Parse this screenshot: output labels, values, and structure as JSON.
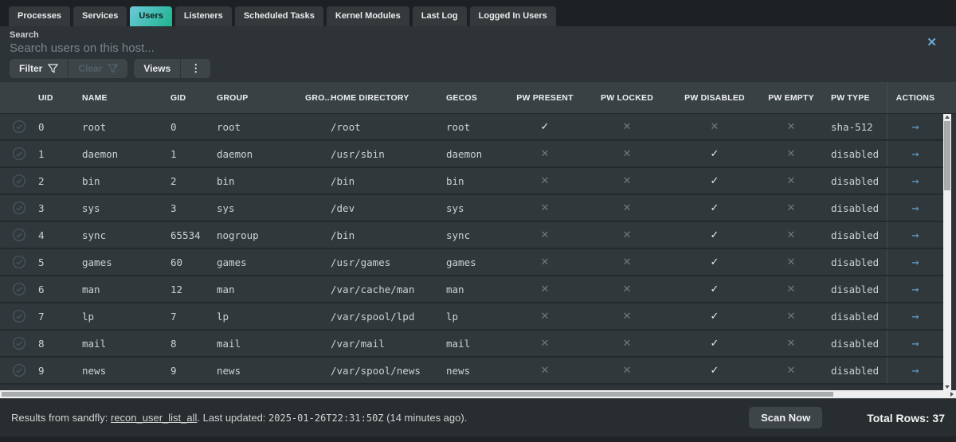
{
  "tabs": [
    {
      "label": "Processes",
      "active": false
    },
    {
      "label": "Services",
      "active": false
    },
    {
      "label": "Users",
      "active": true
    },
    {
      "label": "Listeners",
      "active": false
    },
    {
      "label": "Scheduled Tasks",
      "active": false
    },
    {
      "label": "Kernel Modules",
      "active": false
    },
    {
      "label": "Last Log",
      "active": false
    },
    {
      "label": "Logged In Users",
      "active": false
    }
  ],
  "search": {
    "label": "Search",
    "placeholder": "Search users on this host..."
  },
  "toolbar": {
    "filter": "Filter",
    "clear": "Clear",
    "views": "Views"
  },
  "table": {
    "headers": {
      "uid": "UID",
      "name": "NAME",
      "gid": "GID",
      "group": "GROUP",
      "groups": "GRO...",
      "home": "HOME DIRECTORY",
      "gecos": "GECOS",
      "pw_present": "PW PRESENT",
      "pw_locked": "PW LOCKED",
      "pw_disabled": "PW DISABLED",
      "pw_empty": "PW EMPTY",
      "pw_type": "PW TYPE",
      "actions": "ACTIONS"
    },
    "check_glyph": "✓",
    "cross_glyph": "✕",
    "action_glyph": "→",
    "rows": [
      {
        "uid": "0",
        "name": "root",
        "gid": "0",
        "group": "root",
        "groups": "",
        "home": "/root",
        "gecos": "root",
        "pw_present": true,
        "pw_locked": false,
        "pw_disabled": false,
        "pw_empty": false,
        "pw_type": "sha-512"
      },
      {
        "uid": "1",
        "name": "daemon",
        "gid": "1",
        "group": "daemon",
        "groups": "",
        "home": "/usr/sbin",
        "gecos": "daemon",
        "pw_present": false,
        "pw_locked": false,
        "pw_disabled": true,
        "pw_empty": false,
        "pw_type": "disabled"
      },
      {
        "uid": "2",
        "name": "bin",
        "gid": "2",
        "group": "bin",
        "groups": "",
        "home": "/bin",
        "gecos": "bin",
        "pw_present": false,
        "pw_locked": false,
        "pw_disabled": true,
        "pw_empty": false,
        "pw_type": "disabled"
      },
      {
        "uid": "3",
        "name": "sys",
        "gid": "3",
        "group": "sys",
        "groups": "",
        "home": "/dev",
        "gecos": "sys",
        "pw_present": false,
        "pw_locked": false,
        "pw_disabled": true,
        "pw_empty": false,
        "pw_type": "disabled"
      },
      {
        "uid": "4",
        "name": "sync",
        "gid": "65534",
        "group": "nogroup",
        "groups": "",
        "home": "/bin",
        "gecos": "sync",
        "pw_present": false,
        "pw_locked": false,
        "pw_disabled": true,
        "pw_empty": false,
        "pw_type": "disabled"
      },
      {
        "uid": "5",
        "name": "games",
        "gid": "60",
        "group": "games",
        "groups": "",
        "home": "/usr/games",
        "gecos": "games",
        "pw_present": false,
        "pw_locked": false,
        "pw_disabled": true,
        "pw_empty": false,
        "pw_type": "disabled"
      },
      {
        "uid": "6",
        "name": "man",
        "gid": "12",
        "group": "man",
        "groups": "",
        "home": "/var/cache/man",
        "gecos": "man",
        "pw_present": false,
        "pw_locked": false,
        "pw_disabled": true,
        "pw_empty": false,
        "pw_type": "disabled"
      },
      {
        "uid": "7",
        "name": "lp",
        "gid": "7",
        "group": "lp",
        "groups": "",
        "home": "/var/spool/lpd",
        "gecos": "lp",
        "pw_present": false,
        "pw_locked": false,
        "pw_disabled": true,
        "pw_empty": false,
        "pw_type": "disabled"
      },
      {
        "uid": "8",
        "name": "mail",
        "gid": "8",
        "group": "mail",
        "groups": "",
        "home": "/var/mail",
        "gecos": "mail",
        "pw_present": false,
        "pw_locked": false,
        "pw_disabled": true,
        "pw_empty": false,
        "pw_type": "disabled"
      },
      {
        "uid": "9",
        "name": "news",
        "gid": "9",
        "group": "news",
        "groups": "",
        "home": "/var/spool/news",
        "gecos": "news",
        "pw_present": false,
        "pw_locked": false,
        "pw_disabled": true,
        "pw_empty": false,
        "pw_type": "disabled"
      }
    ]
  },
  "footer": {
    "results_prefix": "Results from sandfly: ",
    "sandfly_link": "recon_user_list_all",
    "updated_mid": ". Last updated: ",
    "timestamp": "2025-01-26T22:31:50Z",
    "updated_suffix": " (14 minutes ago).",
    "scan_button": "Scan Now",
    "total_rows": "Total Rows: 37"
  },
  "colors": {
    "active_tab_gradient_start": "#6bc9d9",
    "active_tab_gradient_end": "#1eb48e",
    "link_blue": "#6ea9d8",
    "action_arrow_blue": "#5f9fd0",
    "check_mark": "#e7eaea",
    "cross_mark": "#6e797d"
  }
}
